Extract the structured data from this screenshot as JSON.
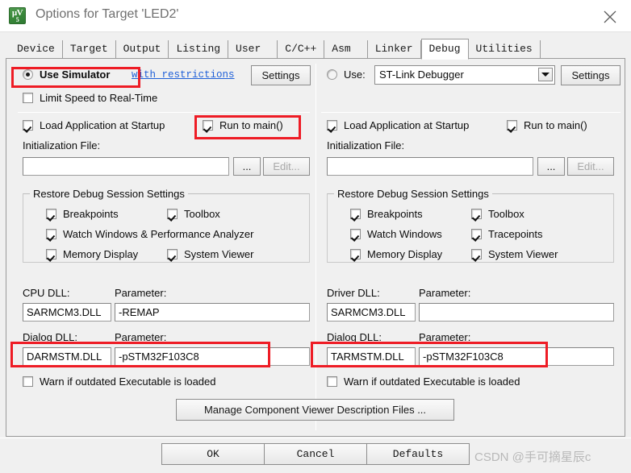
{
  "window": {
    "title": "Options for Target 'LED2'",
    "icon": "uvision-logo-icon",
    "close_label": "×"
  },
  "tabs": [
    {
      "label": "Device",
      "selected": false
    },
    {
      "label": "Target",
      "selected": false
    },
    {
      "label": "Output",
      "selected": false
    },
    {
      "label": "Listing",
      "selected": false
    },
    {
      "label": "User",
      "selected": false
    },
    {
      "label": "C/C++",
      "selected": false
    },
    {
      "label": "Asm",
      "selected": false
    },
    {
      "label": "Linker",
      "selected": false
    },
    {
      "label": "Debug",
      "selected": true
    },
    {
      "label": "Utilities",
      "selected": false
    }
  ],
  "simulator": {
    "radio_label": "Use Simulator",
    "radio_checked": "on",
    "restrictions_link": "with restrictions",
    "settings_label": "Settings",
    "limit_speed_label": "Limit Speed to Real-Time",
    "limit_speed_checked": "off",
    "load_app_label": "Load Application at Startup",
    "load_app_checked": "on",
    "run_to_main_label": "Run to main()",
    "run_to_main_checked": "on",
    "init_file_label": "Initialization File:",
    "init_file_value": "",
    "browse_label": "...",
    "edit_label": "Edit...",
    "restore_group_title": "Restore Debug Session Settings",
    "restore_items": [
      {
        "label": "Breakpoints",
        "checked": "on"
      },
      {
        "label": "Toolbox",
        "checked": "on"
      },
      {
        "label": "Watch Windows & Performance Analyzer",
        "checked": "on"
      },
      {
        "label": "Memory Display",
        "checked": "on"
      },
      {
        "label": "System Viewer",
        "checked": "on"
      }
    ],
    "cpu_dll_label": "CPU DLL:",
    "cpu_dll_value": "SARMCM3.DLL",
    "cpu_param_label": "Parameter:",
    "cpu_param_value": "-REMAP",
    "dialog_dll_label": "Dialog DLL:",
    "dialog_dll_value": "DARMSTM.DLL",
    "dialog_param_label": "Parameter:",
    "dialog_param_value": "-pSTM32F103C8",
    "warn_outdated_label": "Warn if outdated Executable is loaded",
    "warn_outdated_checked": "off"
  },
  "debugger": {
    "radio_label": "Use:",
    "radio_checked": "off",
    "selected_driver": "ST-Link Debugger",
    "settings_label": "Settings",
    "load_app_label": "Load Application at Startup",
    "load_app_checked": "on",
    "run_to_main_label": "Run to main()",
    "run_to_main_checked": "on",
    "init_file_label": "Initialization File:",
    "init_file_value": "",
    "browse_label": "...",
    "edit_label": "Edit...",
    "restore_group_title": "Restore Debug Session Settings",
    "restore_items": [
      {
        "label": "Breakpoints",
        "checked": "on"
      },
      {
        "label": "Toolbox",
        "checked": "on"
      },
      {
        "label": "Watch Windows",
        "checked": "on"
      },
      {
        "label": "Tracepoints",
        "checked": "on"
      },
      {
        "label": "Memory Display",
        "checked": "on"
      },
      {
        "label": "System Viewer",
        "checked": "on"
      }
    ],
    "driver_dll_label": "Driver DLL:",
    "driver_dll_value": "SARMCM3.DLL",
    "driver_param_label": "Parameter:",
    "driver_param_value": "",
    "dialog_dll_label": "Dialog DLL:",
    "dialog_dll_value": "TARMSTM.DLL",
    "dialog_param_label": "Parameter:",
    "dialog_param_value": "-pSTM32F103C8",
    "warn_outdated_label": "Warn if outdated Executable is loaded",
    "warn_outdated_checked": "off"
  },
  "footer": {
    "manage_label": "Manage Component Viewer Description Files ...",
    "ok_label": "OK",
    "cancel_label": "Cancel",
    "defaults_label": "Defaults"
  },
  "watermark": "CSDN @手可摘星辰c",
  "annotations": {
    "accent_color": "#ee1c25",
    "boxes": [
      "use-simulator-radio",
      "run-to-main-left",
      "dialog-dll-left",
      "dialog-dll-right"
    ]
  }
}
